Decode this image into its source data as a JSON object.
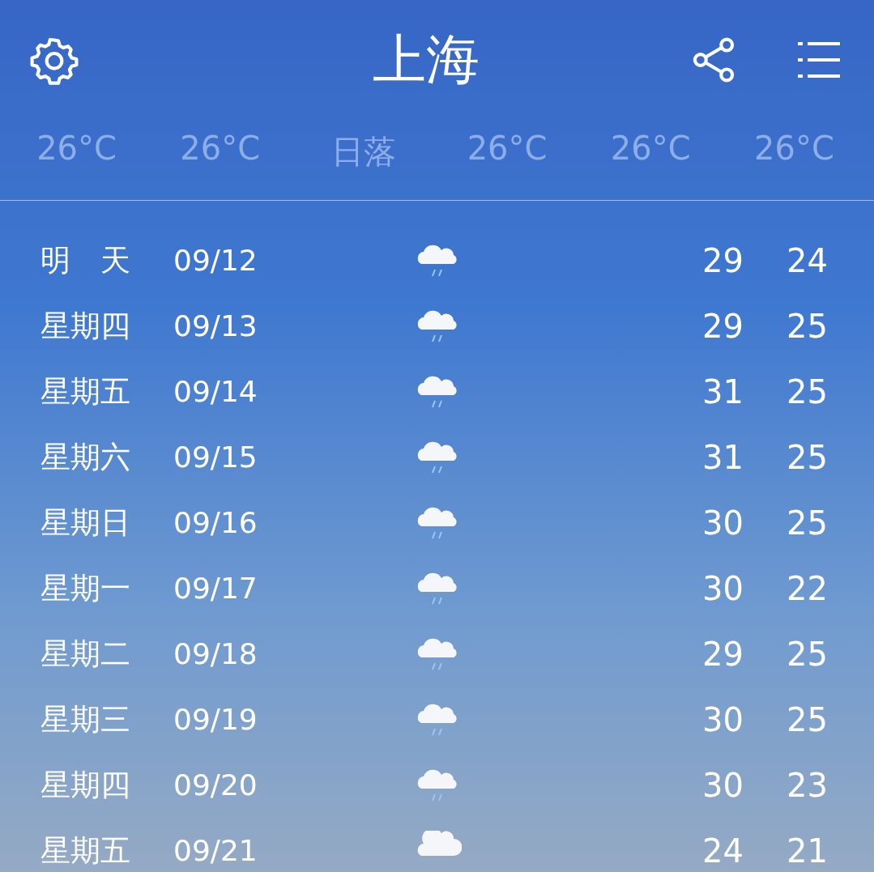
{
  "header": {
    "title": "上海"
  },
  "hourly": [
    "26°C",
    "26°C",
    "日落",
    "26°C",
    "26°C",
    "26°C"
  ],
  "forecast": [
    {
      "day": "明　天",
      "date": "09/12",
      "kind": "rain",
      "high": "29",
      "low": "24"
    },
    {
      "day": "星期四",
      "date": "09/13",
      "kind": "rain",
      "high": "29",
      "low": "25"
    },
    {
      "day": "星期五",
      "date": "09/14",
      "kind": "rain",
      "high": "31",
      "low": "25"
    },
    {
      "day": "星期六",
      "date": "09/15",
      "kind": "rain",
      "high": "31",
      "low": "25"
    },
    {
      "day": "星期日",
      "date": "09/16",
      "kind": "rain",
      "high": "30",
      "low": "25"
    },
    {
      "day": "星期一",
      "date": "09/17",
      "kind": "rain",
      "high": "30",
      "low": "22"
    },
    {
      "day": "星期二",
      "date": "09/18",
      "kind": "rain",
      "high": "29",
      "low": "25"
    },
    {
      "day": "星期三",
      "date": "09/19",
      "kind": "rain",
      "high": "30",
      "low": "25"
    },
    {
      "day": "星期四",
      "date": "09/20",
      "kind": "rain",
      "high": "30",
      "low": "23"
    },
    {
      "day": "星期五",
      "date": "09/21",
      "kind": "cloud",
      "high": "24",
      "low": "21"
    }
  ]
}
